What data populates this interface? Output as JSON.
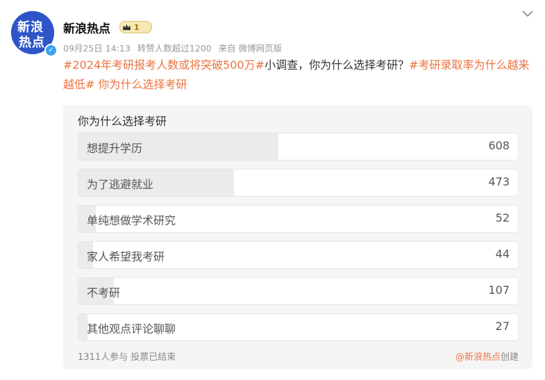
{
  "post": {
    "avatar": {
      "line1": "新浪",
      "line2": "热点"
    },
    "username": "新浪热点",
    "badge_level": "1",
    "meta": {
      "time": "09月25日 14:13",
      "reposts": "转赞人数超过1200",
      "source": "来自 微博网页版"
    },
    "content": {
      "tag1": "#2024年考研报考人数或将突破500万#",
      "text": "小调查，你为什么选择考研？",
      "tag2": "#考研录取率为什么越来越低#",
      "tag3": " 你为什么选择考研"
    }
  },
  "poll": {
    "title": "你为什么选择考研",
    "options": [
      {
        "label": "想提升学历",
        "count": "608",
        "votes": 608
      },
      {
        "label": "为了逃避就业",
        "count": "473",
        "votes": 473
      },
      {
        "label": "单纯想做学术研究",
        "count": "52",
        "votes": 52
      },
      {
        "label": "家人希望我考研",
        "count": "44",
        "votes": 44
      },
      {
        "label": "不考研",
        "count": "107",
        "votes": 107
      },
      {
        "label": "其他观点评论聊聊",
        "count": "27",
        "votes": 27
      }
    ],
    "footer": "1311人参与  投票已结束",
    "creator_link": "@新浪热点",
    "creator_suffix": "创建"
  },
  "colors": {
    "accent": "#eb7340",
    "verified": "#3aa0f3",
    "avatar": "#2f55c9"
  },
  "icons": {
    "verified": "verified-check-icon",
    "crown": "crown-icon",
    "more": "chevron-down-icon"
  }
}
